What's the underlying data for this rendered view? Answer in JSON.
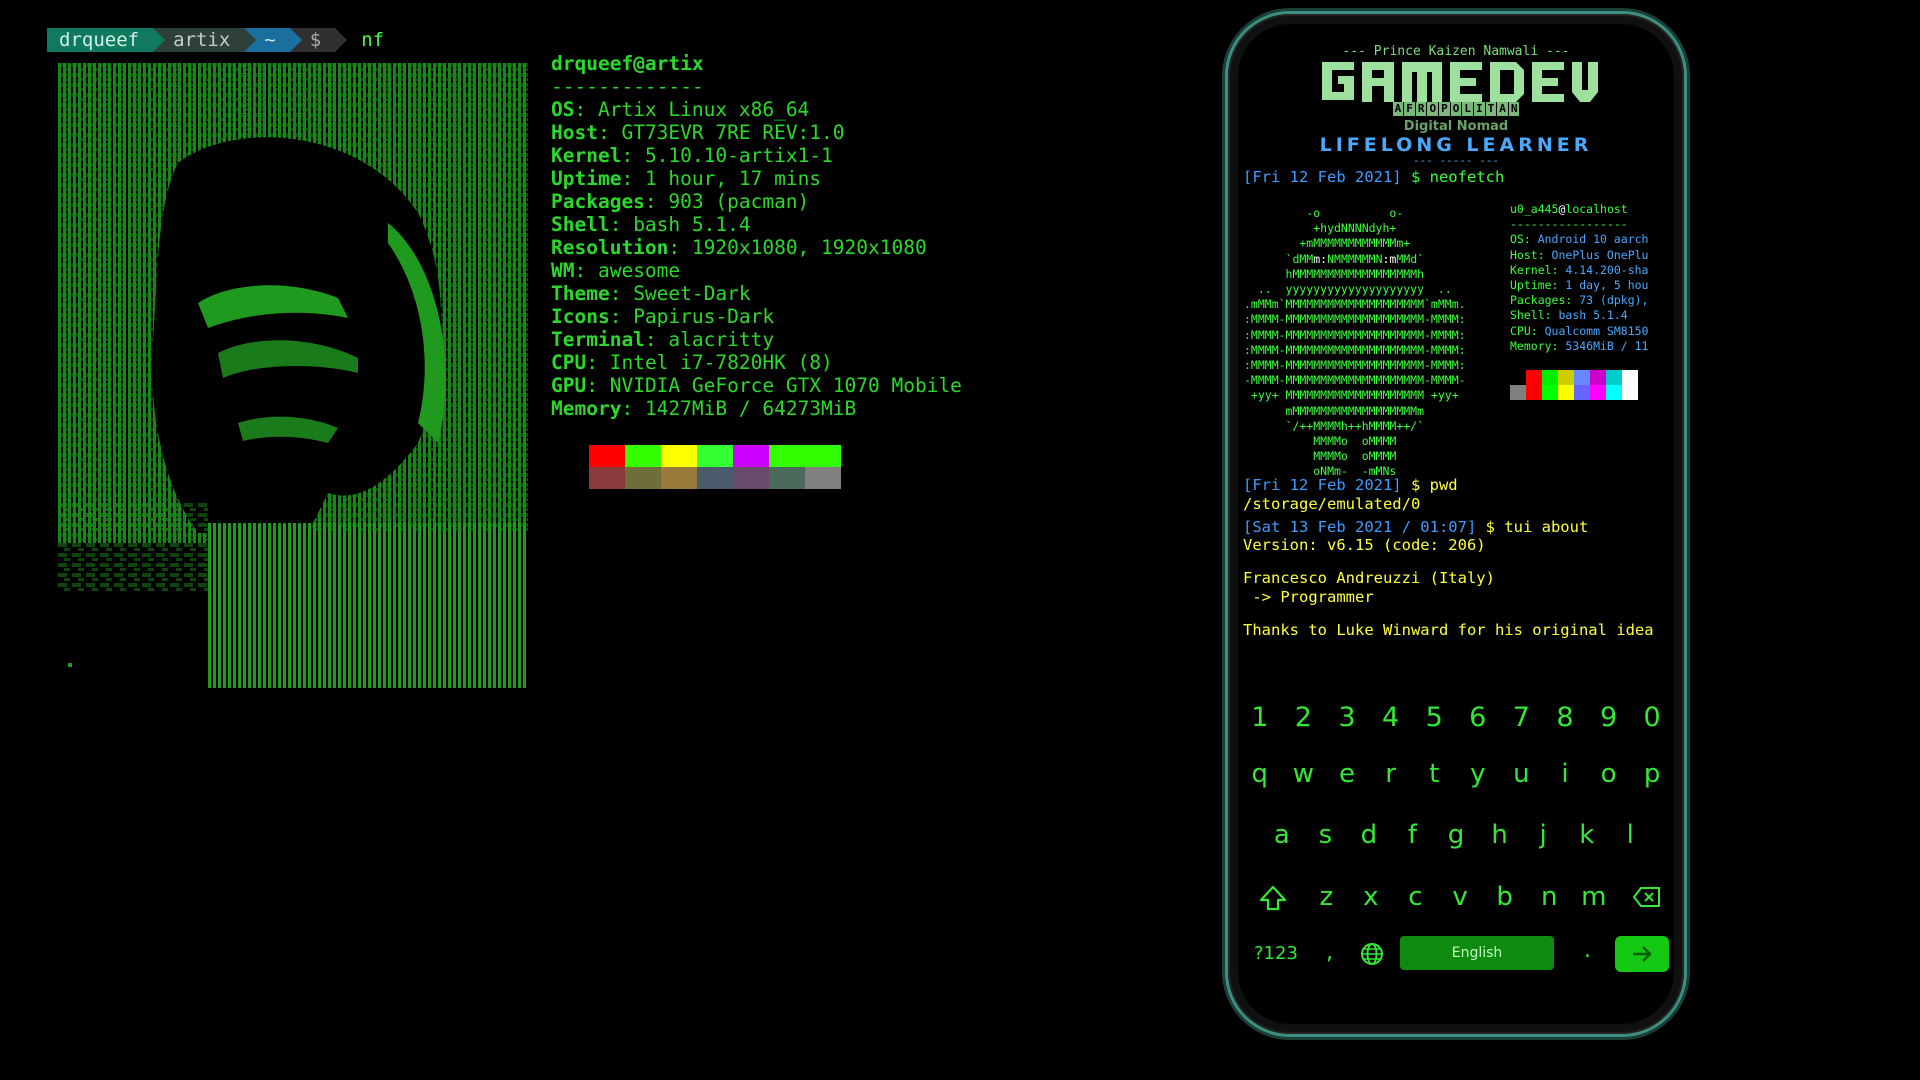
{
  "desktop": {
    "prompt": {
      "user": "drqueef",
      "host": "artix",
      "dir": "~",
      "symbol": "$",
      "command": "nf"
    },
    "neofetch": {
      "title": "drqueef@artix",
      "separator": "-------------",
      "rows": [
        {
          "key": "OS",
          "value": " Artix Linux x86_64"
        },
        {
          "key": "Host",
          "value": " GT73EVR 7RE REV:1.0"
        },
        {
          "key": "Kernel",
          "value": " 5.10.10-artix1-1"
        },
        {
          "key": "Uptime",
          "value": " 1 hour, 17 mins"
        },
        {
          "key": "Packages",
          "value": " 903 (pacman)"
        },
        {
          "key": "Shell",
          "value": " bash 5.1.4"
        },
        {
          "key": "Resolution",
          "value": " 1920x1080, 1920x1080"
        },
        {
          "key": "WM",
          "value": " awesome"
        },
        {
          "key": "Theme",
          "value": " Sweet-Dark"
        },
        {
          "key": "Icons",
          "value": " Papirus-Dark"
        },
        {
          "key": "Terminal",
          "value": " alacritty"
        },
        {
          "key": "CPU",
          "value": " Intel i7-7820HK (8)"
        },
        {
          "key": "GPU",
          "value": " NVIDIA GeForce GTX 1070 Mobile"
        },
        {
          "key": "Memory",
          "value": " 1427MiB / 64273MiB"
        }
      ],
      "palette_top": [
        "#ff0000",
        "#33ff00",
        "#ffff00",
        "#33ff33",
        "#cc00ff",
        "#33ff00",
        "#33ff00"
      ],
      "palette_bottom": [
        "#8a3a3a",
        "#6e6e3a",
        "#9a7a3a",
        "#4a5a6a",
        "#6a4a6a",
        "#4a6a5a",
        "#808080"
      ]
    }
  },
  "phone": {
    "credit": "--- Prince Kaizen Namwali ---",
    "logo_text": "GAMEDEV",
    "afro": "AFROPOLITAN",
    "nomad": "Digital Nomad",
    "lifelong": "LIFELONG LEARNER",
    "lifelong_dash": "--- ----- ---",
    "cmd1": {
      "date": "[Fri 12 Feb 2021]",
      "text": " $ neofetch"
    },
    "neo_info": [
      {
        "k": "OS: ",
        "v": "Android 10 aarch"
      },
      {
        "k": "Host: ",
        "v": "OnePlus OnePlu"
      },
      {
        "k": "Kernel: ",
        "v": "4.14.200-sha"
      },
      {
        "k": "Uptime: ",
        "v": "1 day, 5 hou"
      },
      {
        "k": "Packages: ",
        "v": "73 (dpkg),"
      },
      {
        "k": "Shell: ",
        "v": "bash 5.1.4"
      },
      {
        "k": "CPU: ",
        "v": "Qualcomm SM8150"
      },
      {
        "k": "Memory: ",
        "v": "5346MiB / 11"
      }
    ],
    "neo_user": "u0_a445",
    "neo_at": "@",
    "neo_host": "localhost",
    "neo_sep": "-----------------",
    "neo_pal_top": [
      "#000000",
      "#ff0000",
      "#00ee00",
      "#cccc00",
      "#6688ff",
      "#cc00cc",
      "#00cccc",
      "#ffffff"
    ],
    "neo_pal_bottom": [
      "#808080",
      "#ff0000",
      "#00ff00",
      "#ffff00",
      "#6666ff",
      "#ff00ff",
      "#00ffff",
      "#ffffff"
    ],
    "cmd2": {
      "date": "[Fri 12 Feb 2021]",
      "text": " $ pwd"
    },
    "pwd_out": "/storage/emulated/0",
    "cmd3": {
      "date": "[Sat 13 Feb 2021 / 01:07]",
      "text": " $ tui about"
    },
    "about": {
      "version": "Version: v6.15 (code: 206)",
      "author": "Francesco Andreuzzi (Italy)",
      "role": " -> Programmer",
      "thanks": "Thanks to Luke Winward for his original idea"
    },
    "keyboard": {
      "numbers": [
        "1",
        "2",
        "3",
        "4",
        "5",
        "6",
        "7",
        "8",
        "9",
        "0"
      ],
      "row1": [
        "q",
        "w",
        "e",
        "r",
        "t",
        "y",
        "u",
        "i",
        "o",
        "p"
      ],
      "row2": [
        "a",
        "s",
        "d",
        "f",
        "g",
        "h",
        "j",
        "k",
        "l"
      ],
      "row3": [
        "z",
        "x",
        "c",
        "v",
        "b",
        "n",
        "m"
      ],
      "sym": "?123",
      "comma": ",",
      "space": "English",
      "dot": "."
    }
  }
}
